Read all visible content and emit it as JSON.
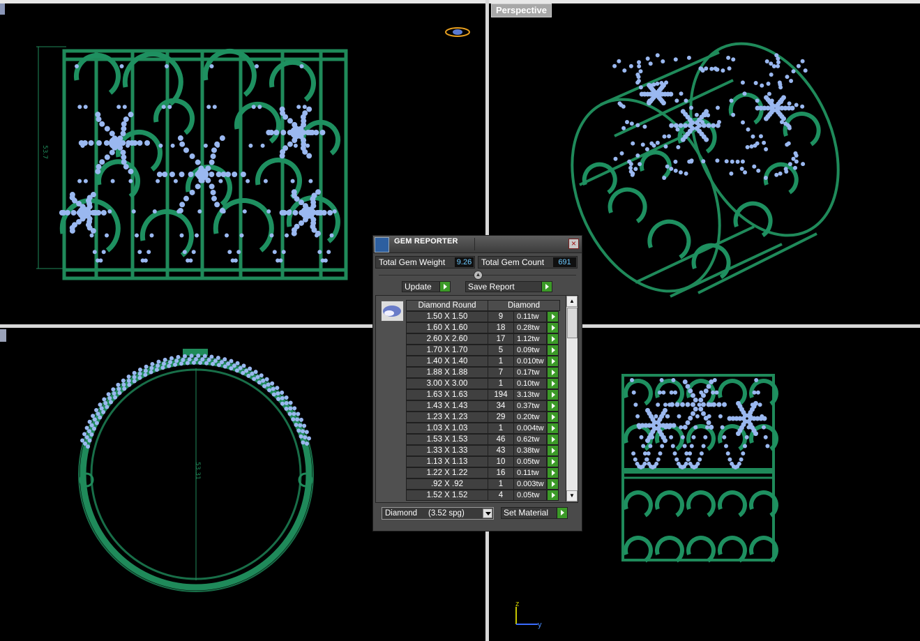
{
  "viewports": {
    "top_right_label": "Perspective",
    "dimension_front": "53.7",
    "dimension_top": "53.31"
  },
  "axis": {
    "z": "z",
    "y": "y"
  },
  "colors": {
    "metal": "#1f8a5a",
    "gems": "#9ab8f0",
    "background": "#000000",
    "accent_go": "#3c9a28"
  },
  "gem_reporter": {
    "title": "GEM REPORTER",
    "total_weight_label": "Total Gem Weight",
    "total_weight_value": "9.26",
    "total_count_label": "Total Gem Count",
    "total_count_value": "691",
    "update_label": "Update",
    "save_report_label": "Save Report",
    "headers": {
      "shape": "Diamond Round",
      "material": "Diamond"
    },
    "rows": [
      {
        "size": "1.50 X 1.50",
        "count": "9",
        "weight": "0.11tw"
      },
      {
        "size": "1.60 X 1.60",
        "count": "18",
        "weight": "0.28tw"
      },
      {
        "size": "2.60 X 2.60",
        "count": "17",
        "weight": "1.12tw"
      },
      {
        "size": "1.70 X 1.70",
        "count": "5",
        "weight": "0.09tw"
      },
      {
        "size": "1.40 X 1.40",
        "count": "1",
        "weight": "0.010tw"
      },
      {
        "size": "1.88 X 1.88",
        "count": "7",
        "weight": "0.17tw"
      },
      {
        "size": "3.00 X 3.00",
        "count": "1",
        "weight": "0.10tw"
      },
      {
        "size": "1.63 X 1.63",
        "count": "194",
        "weight": "3.13tw"
      },
      {
        "size": "1.43 X 1.43",
        "count": "34",
        "weight": "0.37tw"
      },
      {
        "size": "1.23 X 1.23",
        "count": "29",
        "weight": "0.20tw"
      },
      {
        "size": "1.03 X 1.03",
        "count": "1",
        "weight": "0.004tw"
      },
      {
        "size": "1.53 X 1.53",
        "count": "46",
        "weight": "0.62tw"
      },
      {
        "size": "1.33 X 1.33",
        "count": "43",
        "weight": "0.38tw"
      },
      {
        "size": "1.13 X 1.13",
        "count": "10",
        "weight": "0.05tw"
      },
      {
        "size": "1.22 X 1.22",
        "count": "16",
        "weight": "0.11tw"
      },
      {
        "size": ".92 X .92",
        "count": "1",
        "weight": "0.003tw"
      },
      {
        "size": "1.52 X 1.52",
        "count": "4",
        "weight": "0.05tw"
      }
    ],
    "material_select": "Diamond     (3.52 spg)",
    "set_material_label": "Set Material"
  }
}
